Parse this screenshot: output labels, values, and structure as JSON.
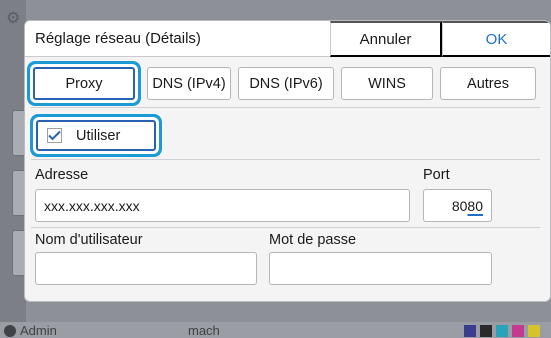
{
  "background": {
    "footer_user": "Admin",
    "footer_center": "mach"
  },
  "dialog": {
    "title": "Réglage réseau (Détails)",
    "cancel_label": "Annuler",
    "ok_label": "OK"
  },
  "tabs": [
    {
      "label": "Proxy",
      "active": true
    },
    {
      "label": "DNS (IPv4)",
      "active": false
    },
    {
      "label": "DNS (IPv6)",
      "active": false
    },
    {
      "label": "WINS",
      "active": false
    },
    {
      "label": "Autres",
      "active": false
    }
  ],
  "use_proxy": {
    "label": "Utiliser",
    "checked": true
  },
  "fields": {
    "address": {
      "label": "Adresse",
      "value": "xxx.xxx.xxx.xxx"
    },
    "port": {
      "label": "Port",
      "value_main": "80",
      "value_caret": "80"
    },
    "username": {
      "label": "Nom d'utilisateur",
      "value": ""
    },
    "password": {
      "label": "Mot de passe",
      "value": ""
    }
  },
  "colors": {
    "accent": "#1f6fc9",
    "focus_ring": "#1b9ad6",
    "selected_border": "#2a62b3"
  }
}
